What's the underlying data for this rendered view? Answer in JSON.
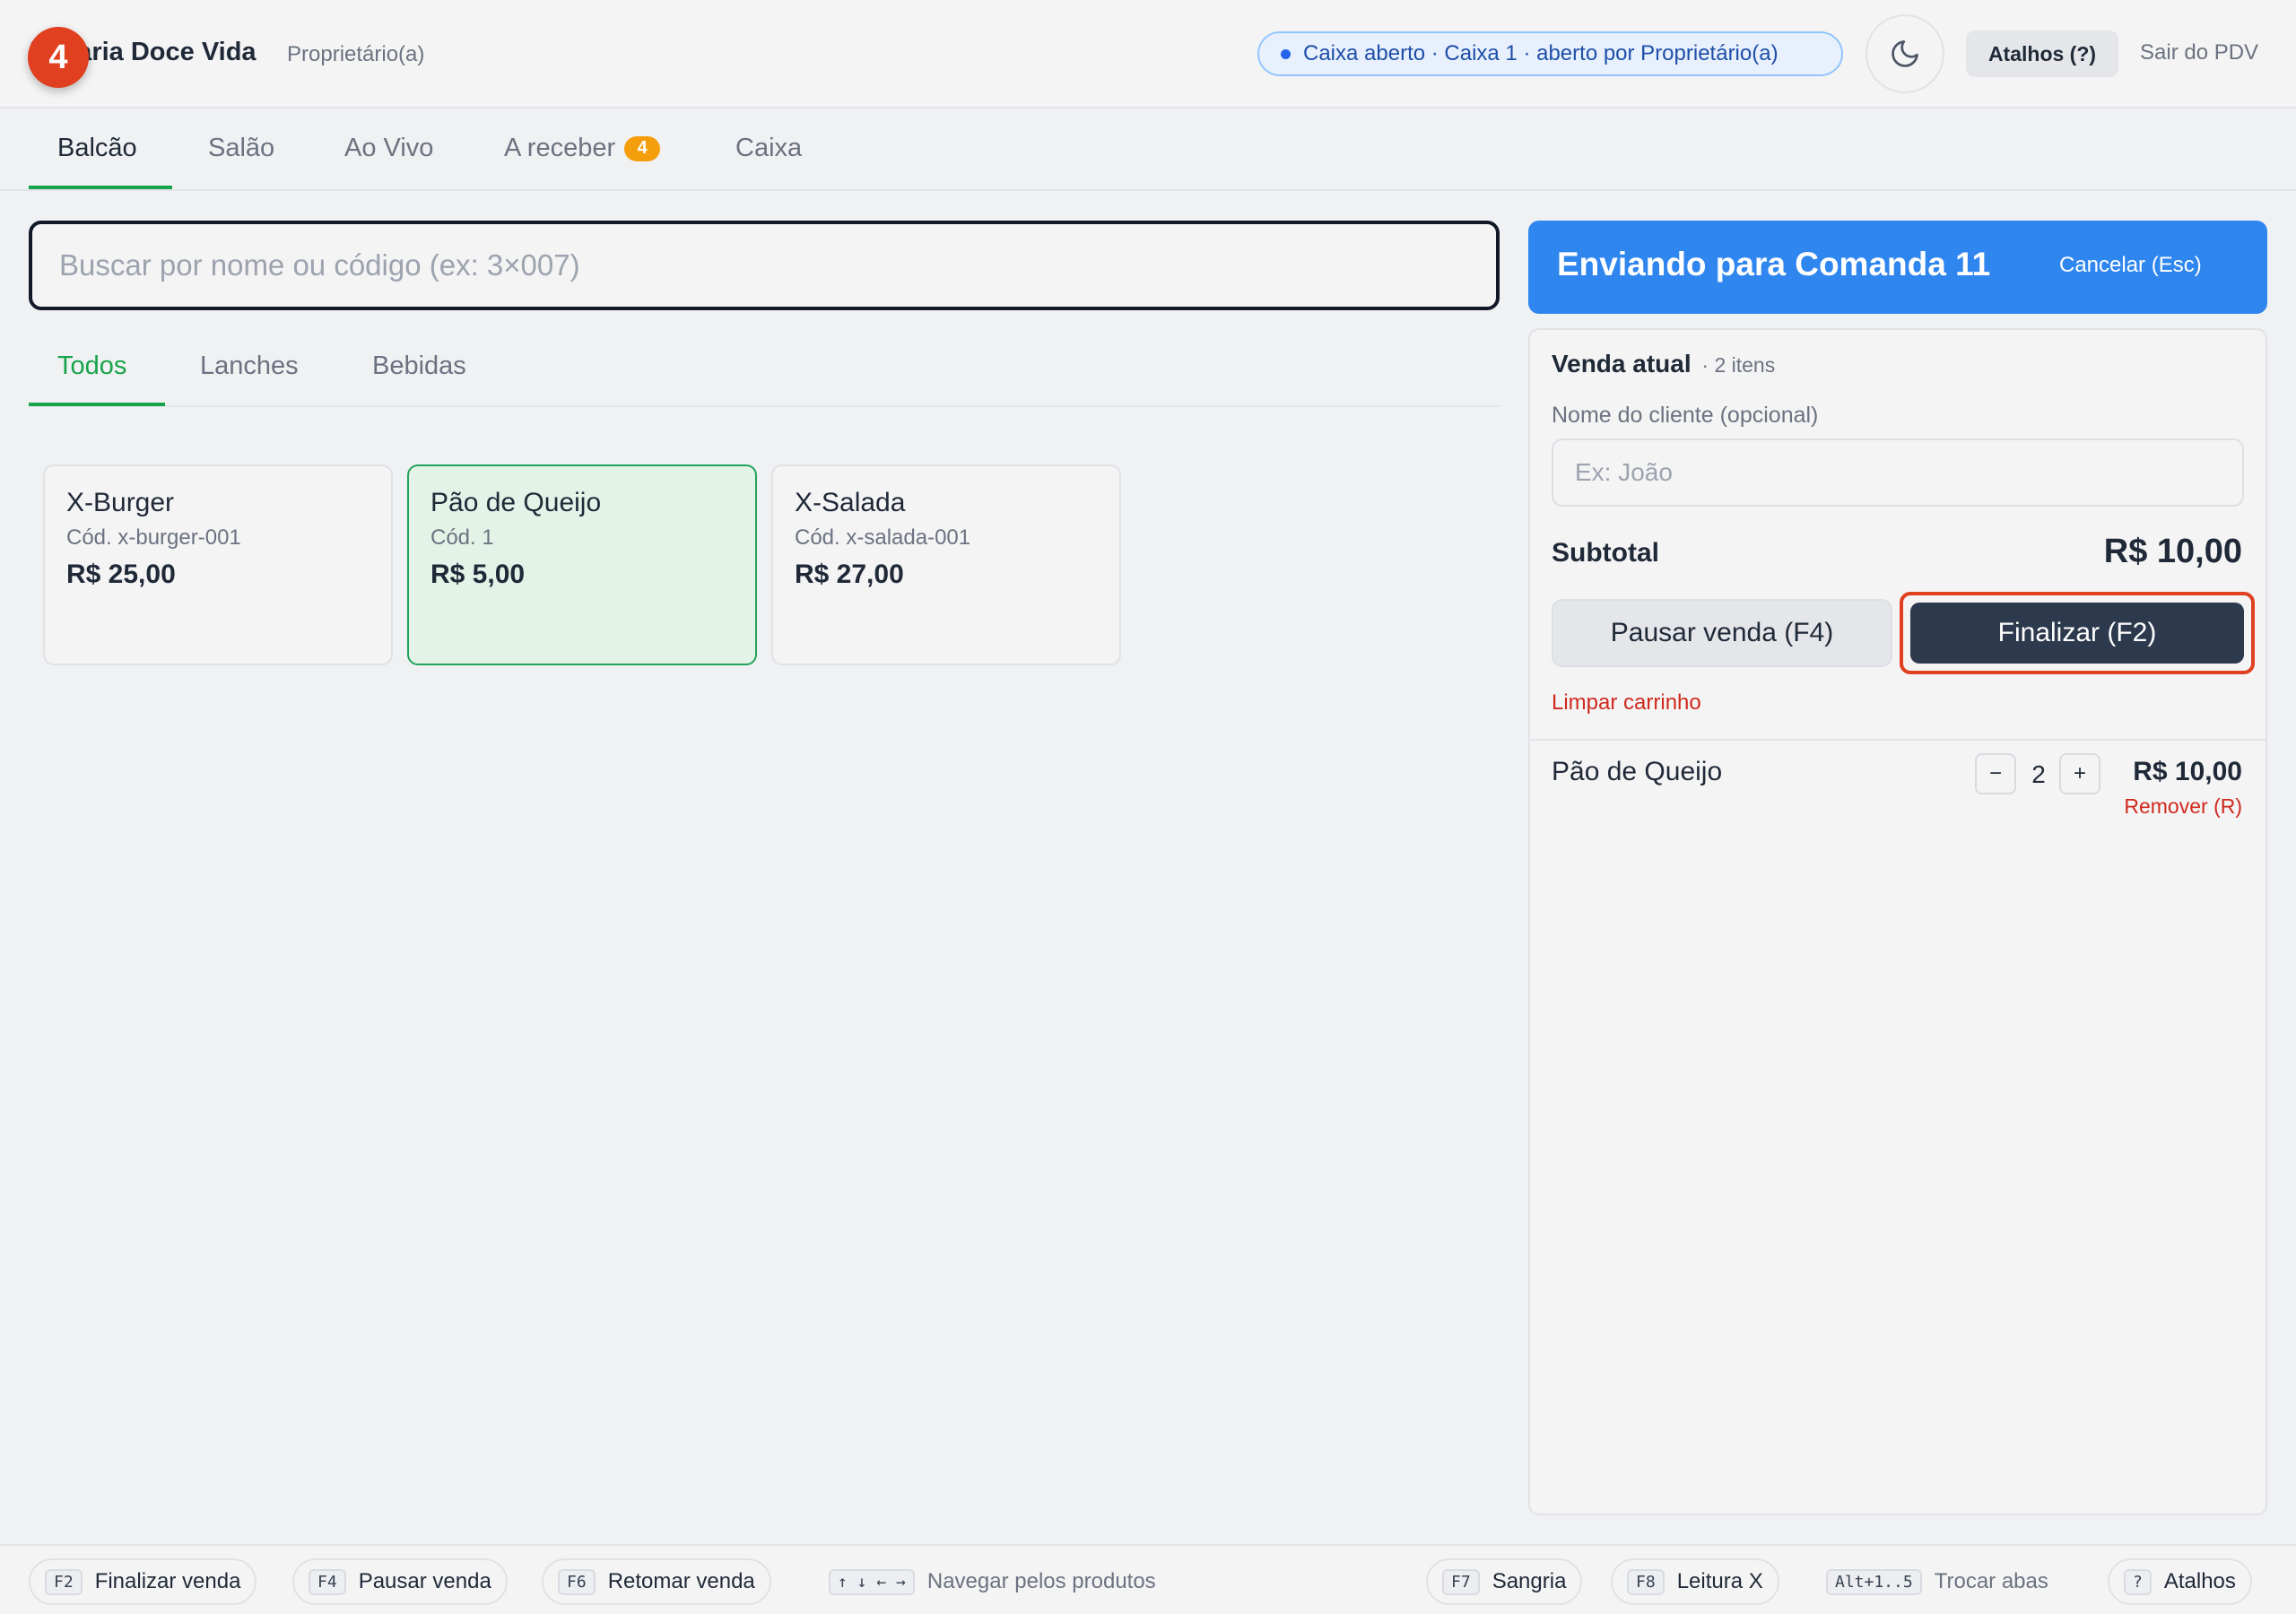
{
  "header": {
    "brand": "Padaria Doce Vida",
    "role": "Proprietário(a)",
    "step_badge": "4",
    "status": "Caixa aberto · Caixa 1 · aberto por Proprietário(a)",
    "shortcuts_label": "Atalhos (?)",
    "exit_label": "Sair do PDV"
  },
  "main_tabs": [
    {
      "label": "Balcão",
      "active": true
    },
    {
      "label": "Salão"
    },
    {
      "label": "Ao Vivo"
    },
    {
      "label": "A receber",
      "badge": "4"
    },
    {
      "label": "Caixa"
    }
  ],
  "search": {
    "placeholder": "Buscar por nome ou código (ex: 3×007)",
    "value": ""
  },
  "category_tabs": [
    {
      "label": "Todos",
      "active": true
    },
    {
      "label": "Lanches"
    },
    {
      "label": "Bebidas"
    }
  ],
  "products": [
    {
      "name": "X-Burger",
      "code": "Cód. x-burger-001",
      "price": "R$ 25,00"
    },
    {
      "name": "Pão de Queijo",
      "code": "Cód. 1",
      "price": "R$ 5,00",
      "selected": true
    },
    {
      "name": "X-Salada",
      "code": "Cód. x-salada-001",
      "price": "R$ 27,00"
    }
  ],
  "comanda": {
    "title": "Enviando para Comanda 11",
    "cancel_label": "Cancelar (Esc)"
  },
  "sale": {
    "title": "Venda atual",
    "items_count": "· 2 itens",
    "client_label": "Nome do cliente (opcional)",
    "client_placeholder": "Ex: João",
    "subtotal_label": "Subtotal",
    "subtotal_value": "R$ 10,00",
    "pause_label": "Pausar venda (F4)",
    "finalize_label": "Finalizar (F2)",
    "clear_label": "Limpar carrinho",
    "items": [
      {
        "name": "Pão de Queijo",
        "qty": "2",
        "price": "R$ 10,00",
        "remove_label": "Remover (R)",
        "minus": "−",
        "plus": "+"
      }
    ]
  },
  "footer_hints": [
    {
      "key": "F2",
      "label": "Finalizar venda"
    },
    {
      "key": "F4",
      "label": "Pausar venda"
    },
    {
      "key": "F6",
      "label": "Retomar venda"
    },
    {
      "key": "↑ ↓ ← →",
      "label": "Navegar pelos produtos"
    },
    {
      "key": "F7",
      "label": "Sangria"
    },
    {
      "key": "F8",
      "label": "Leitura X"
    },
    {
      "key": "Alt+1..5",
      "label": "Trocar abas"
    },
    {
      "key": "?",
      "label": "Atalhos"
    }
  ],
  "colors": {
    "accent_green": "#16a34a",
    "comanda_blue": "#2f86ee",
    "finalize_dark": "#2d3a4e",
    "danger_red": "#d0291d",
    "highlight_ring": "#e0401f"
  }
}
